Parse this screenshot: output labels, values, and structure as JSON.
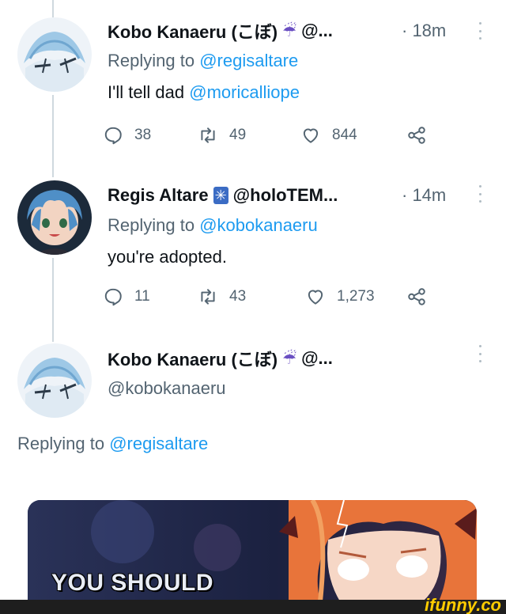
{
  "tweets": [
    {
      "name": "Kobo Kanaeru (こぼ)",
      "badge": "☔",
      "handle": "@...",
      "time": "· 18m",
      "replying_prefix": "Replying to ",
      "replying_to": "@regisaltare",
      "body_prefix": "I'll tell dad ",
      "body_mention": "@moricalliope",
      "replies": "38",
      "retweets": "49",
      "likes": "844"
    },
    {
      "name": "Regis Altare",
      "badge": "✳",
      "handle": "@holoTEM...",
      "time": "· 14m",
      "replying_prefix": "Replying to ",
      "replying_to": "@kobokanaeru",
      "body": "you're adopted.",
      "replies": "11",
      "retweets": "43",
      "likes": "1,273"
    },
    {
      "name": "Kobo Kanaeru (こぼ)",
      "badge": "☔",
      "handle": "@...",
      "sub_handle": "@kobokanaeru",
      "replying_prefix": "Replying to ",
      "replying_to": "@regisaltare"
    }
  ],
  "media": {
    "caption": "YOU SHOULD"
  },
  "watermark": "ifunny.co",
  "colors": {
    "link": "#1d9bf0",
    "secondary_text": "#536471",
    "primary_text": "#0f1419",
    "thread_line": "#cfd9de"
  }
}
